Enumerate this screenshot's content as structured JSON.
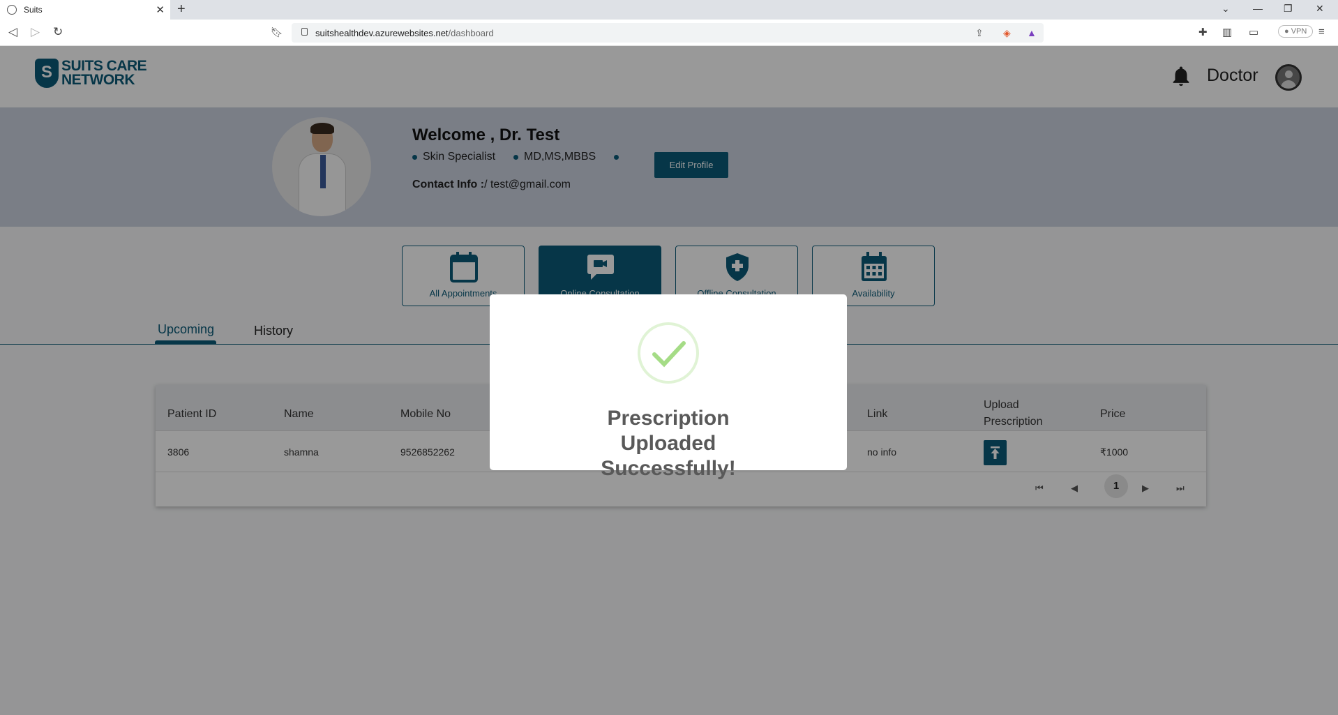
{
  "browser": {
    "tab_title": "Suits",
    "url_host": "suitshealthdev.azurewebsites.net",
    "url_path": "/dashboard",
    "vpn_label": "VPN"
  },
  "header": {
    "logo_line1": "SUITS CARE",
    "logo_line2": "NETWORK",
    "user_label": "Doctor"
  },
  "profile": {
    "welcome": "Welcome , Dr. Test",
    "specialty": "Skin Specialist",
    "degrees": "MD,MS,MBBS",
    "contact_label": "Contact Info :",
    "contact_value": "/ test@gmail.com",
    "edit_label": "Edit Profile"
  },
  "cards": [
    {
      "label": "All Appointments",
      "icon": "calendar-icon"
    },
    {
      "label": "Online Consultation",
      "icon": "video-chat-icon"
    },
    {
      "label": "Offline Consultation",
      "icon": "medical-shield-icon"
    },
    {
      "label": "Availability",
      "icon": "calendar-grid-icon"
    }
  ],
  "tabs": {
    "upcoming": "Upcoming",
    "history": "History"
  },
  "table": {
    "headers": {
      "patient_id": "Patient ID",
      "name": "Name",
      "mobile": "Mobile No",
      "link": "Link",
      "upload_line1": "Upload",
      "upload_line2": "Prescription",
      "price": "Price"
    },
    "rows": [
      {
        "patient_id": "3806",
        "name": "shamna",
        "mobile": "9526852262",
        "link": "no info",
        "price": "₹1000"
      }
    ],
    "page": "1"
  },
  "modal": {
    "title": "Prescription Uploaded Successfully!"
  },
  "colors": {
    "brand": "#0b5a78",
    "success": "#a5dc86"
  }
}
